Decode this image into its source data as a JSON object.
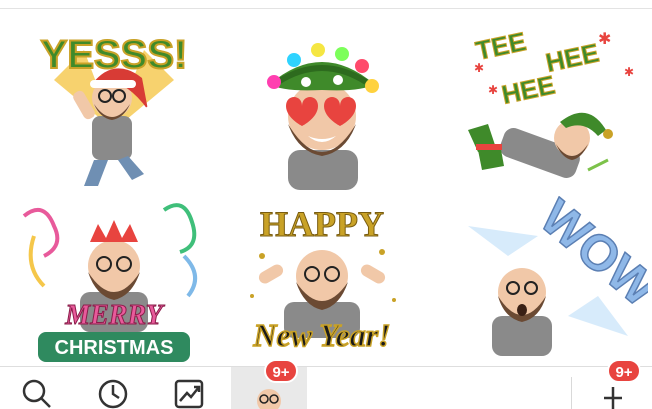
{
  "stickers": [
    {
      "caption": "YESSS!",
      "accent": "#3f8a2a"
    },
    {
      "caption": "",
      "accent": "#e8443f"
    },
    {
      "caption_lines": [
        "TEE",
        "HEE",
        "HEE"
      ],
      "accent": "#3f8a2a"
    },
    {
      "caption_lines": [
        "MERRY",
        "CHRISTMAS"
      ],
      "accent": "#d63a6b"
    },
    {
      "caption_lines": [
        "HAPPY",
        "New Year!"
      ],
      "accent": "#c9a227"
    },
    {
      "caption": "WOW",
      "accent": "#8fb8e8"
    }
  ],
  "tabbar": {
    "icons": [
      "search-icon",
      "recent-clock-icon",
      "trending-icon",
      "sticker-pack-thumb",
      "add-icon"
    ],
    "pack_badge": "9+",
    "store_badge": "9+"
  },
  "colors": {
    "badge": "#e8443f",
    "divider": "#dedede"
  }
}
